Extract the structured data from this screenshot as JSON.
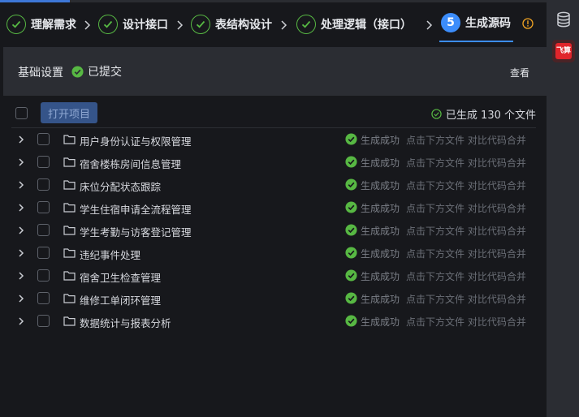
{
  "steps": [
    {
      "label": "理解需求",
      "state": "done"
    },
    {
      "label": "设计接口",
      "state": "done"
    },
    {
      "label": "表结构设计",
      "state": "done"
    },
    {
      "label": "处理逻辑（接口）",
      "state": "done"
    },
    {
      "label": "生成源码",
      "state": "active",
      "number": "5"
    }
  ],
  "settings": {
    "title": "基础设置",
    "status": "已提交",
    "view_label": "查看"
  },
  "toolbar": {
    "open_label": "打开项目",
    "generated_total": "已生成 130 个文件"
  },
  "modules": [
    {
      "name": "用户身份认证与权限管理",
      "status": "生成成功",
      "hint": "点击下方文件 对比代码合并"
    },
    {
      "name": "宿舍楼栋房间信息管理",
      "status": "生成成功",
      "hint": "点击下方文件 对比代码合并"
    },
    {
      "name": "床位分配状态跟踪",
      "status": "生成成功",
      "hint": "点击下方文件 对比代码合并"
    },
    {
      "name": "学生住宿申请全流程管理",
      "status": "生成成功",
      "hint": "点击下方文件 对比代码合并"
    },
    {
      "name": "学生考勤与访客登记管理",
      "status": "生成成功",
      "hint": "点击下方文件 对比代码合并"
    },
    {
      "name": "违纪事件处理",
      "status": "生成成功",
      "hint": "点击下方文件 对比代码合并"
    },
    {
      "name": "宿舍卫生检查管理",
      "status": "生成成功",
      "hint": "点击下方文件 对比代码合并"
    },
    {
      "name": "维修工单闭环管理",
      "status": "生成成功",
      "hint": "点击下方文件 对比代码合并"
    },
    {
      "name": "数据统计与报表分析",
      "status": "生成成功",
      "hint": "点击下方文件 对比代码合并"
    }
  ],
  "icons": {
    "step_done": "check-circle-icon",
    "step_separator": "chevron-right-icon",
    "warning": "info-circle-icon",
    "database": "database-icon",
    "feishu": "feishu-logo-icon",
    "folder": "folder-icon",
    "success": "check-circle-filled-icon"
  },
  "colors": {
    "accent": "#3c8dfb",
    "success": "#57b843",
    "warning": "#f5a623",
    "background": "#17181c",
    "panel": "#2b2d33"
  }
}
